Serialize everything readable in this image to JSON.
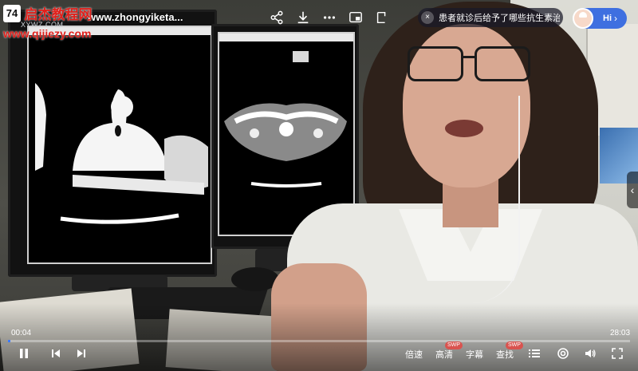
{
  "watermark": {
    "logo": "74",
    "title": "启杰教程网",
    "subtitle": "XYWZ.COM",
    "url": "www.qijiezy.com"
  },
  "header": {
    "video_title": "www.zhongyiketa...",
    "icons": [
      "share-icon",
      "download-icon",
      "more-icon",
      "picture-in-picture-icon",
      "mini-window-icon"
    ]
  },
  "ai_pill": {
    "close": "×",
    "text": "患者就诊后给予了哪些抗生素治..."
  },
  "hi_button": {
    "label": "Hi",
    "chevron": "›"
  },
  "side_tab": {
    "chevron": "‹"
  },
  "player": {
    "current_time": "00:04",
    "total_time": "28:03",
    "progress": 0.0024,
    "speed_label": "倍速",
    "quality_label": "高清",
    "quality_badge": "SWP",
    "subtitle_label": "字幕",
    "search_label": "查找",
    "search_badge": "SWP",
    "accent_color": "#3e7bff",
    "icons": [
      "pause-icon",
      "previous-icon",
      "next-icon",
      "playlist-icon",
      "target-icon",
      "volume-icon",
      "fullscreen-icon"
    ]
  }
}
